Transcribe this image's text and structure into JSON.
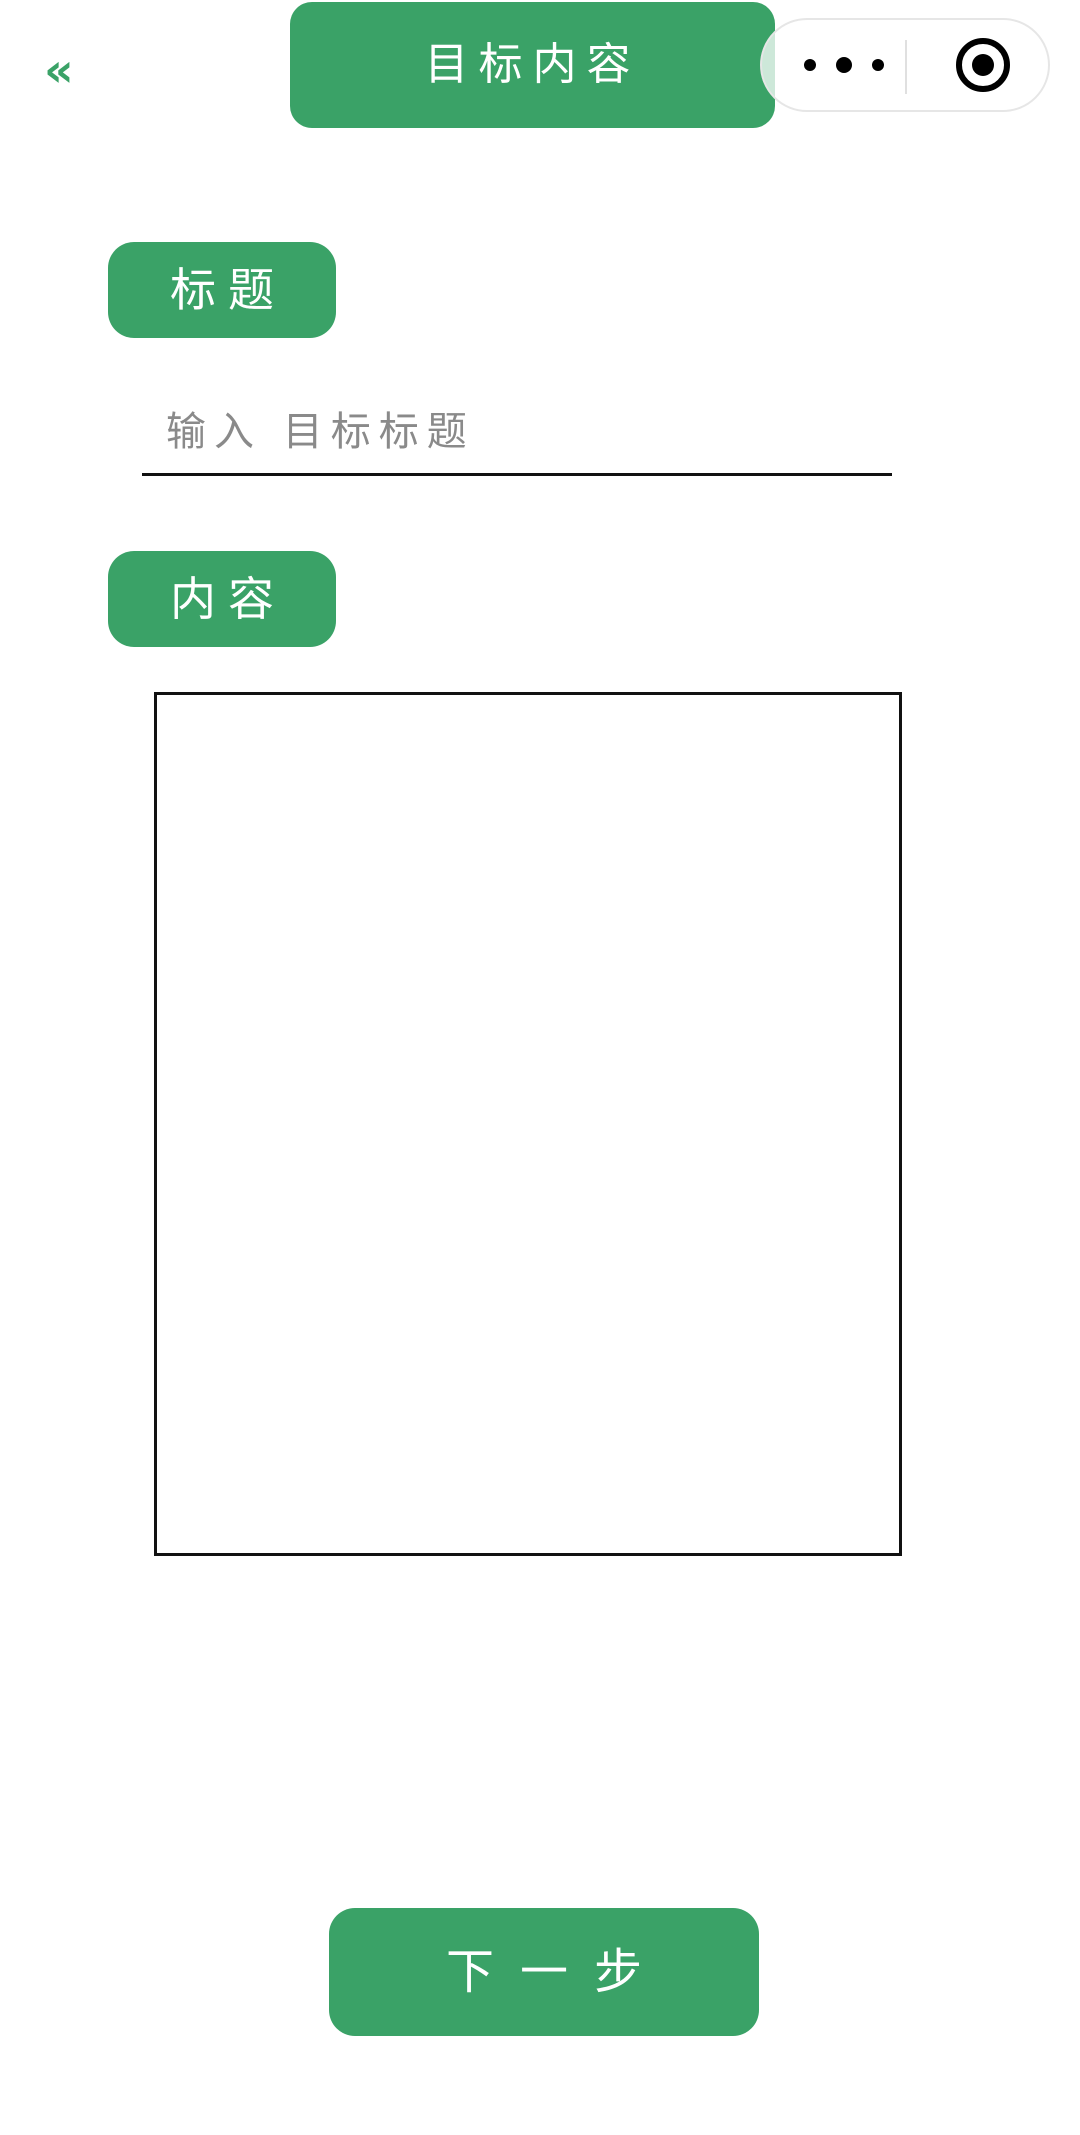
{
  "nav": {
    "back_glyph": "«",
    "title": "目标内容"
  },
  "form": {
    "title_label": "标题",
    "title_placeholder": "输入 目标标题",
    "content_label": "内容",
    "content_value": ""
  },
  "footer": {
    "next_label": "下一步"
  },
  "colors": {
    "accent": "#3aa267",
    "border": "#111111",
    "placeholder": "#8a8a8a"
  },
  "icons": {
    "back": "double-chevron-left-icon",
    "more": "more-dots-icon",
    "close": "target-circle-icon"
  }
}
